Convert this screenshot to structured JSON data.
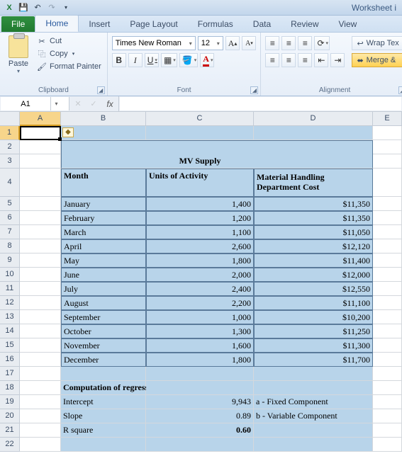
{
  "titlebar": {
    "title": "Worksheet i"
  },
  "tabs": {
    "file": "File",
    "list": [
      "Home",
      "Insert",
      "Page Layout",
      "Formulas",
      "Data",
      "Review",
      "View"
    ],
    "active": "Home"
  },
  "ribbon": {
    "clipboard": {
      "paste": "Paste",
      "cut": "Cut",
      "copy": "Copy",
      "format_painter": "Format Painter",
      "label": "Clipboard"
    },
    "font": {
      "name": "Times New Roman",
      "size": "12",
      "label": "Font"
    },
    "alignment": {
      "wrap": "Wrap Tex",
      "merge": "Merge &",
      "label": "Alignment"
    }
  },
  "namebox": "A1",
  "formula": "",
  "columns": [
    "A",
    "B",
    "C",
    "D",
    "E"
  ],
  "sheet": {
    "title": "MV Supply",
    "headers": {
      "month": "Month",
      "units": "Units of Activity",
      "cost": "Material Handling Department Cost"
    },
    "rows": [
      {
        "month": "January",
        "units": "1,400",
        "cost": "$11,350"
      },
      {
        "month": "February",
        "units": "1,200",
        "cost": "$11,350"
      },
      {
        "month": "March",
        "units": "1,100",
        "cost": "$11,050"
      },
      {
        "month": "April",
        "units": "2,600",
        "cost": "$12,120"
      },
      {
        "month": "May",
        "units": "1,800",
        "cost": "$11,400"
      },
      {
        "month": "June",
        "units": "2,000",
        "cost": "$12,000"
      },
      {
        "month": "July",
        "units": "2,400",
        "cost": "$12,550"
      },
      {
        "month": "August",
        "units": "2,200",
        "cost": "$11,100"
      },
      {
        "month": "September",
        "units": "1,000",
        "cost": "$10,200"
      },
      {
        "month": "October",
        "units": "1,300",
        "cost": "$11,250"
      },
      {
        "month": "November",
        "units": "1,600",
        "cost": "$11,300"
      },
      {
        "month": "December",
        "units": "1,800",
        "cost": "$11,700"
      }
    ],
    "regression": {
      "title": "Computation of regression parameters using excel functions",
      "intercept_l": "Intercept",
      "intercept_v": "9,943",
      "intercept_n": "a - Fixed Component",
      "slope_l": "Slope",
      "slope_v": "0.89",
      "slope_n": "b - Variable Component",
      "rsq_l": "R square",
      "rsq_v": "0.60"
    }
  },
  "chart_data": {
    "type": "table",
    "title": "MV Supply",
    "columns": [
      "Month",
      "Units of Activity",
      "Material Handling Department Cost"
    ],
    "rows": [
      [
        "January",
        1400,
        11350
      ],
      [
        "February",
        1200,
        11350
      ],
      [
        "March",
        1100,
        11050
      ],
      [
        "April",
        2600,
        12120
      ],
      [
        "May",
        1800,
        11400
      ],
      [
        "June",
        2000,
        12000
      ],
      [
        "July",
        2400,
        12550
      ],
      [
        "August",
        2200,
        11100
      ],
      [
        "September",
        1000,
        10200
      ],
      [
        "October",
        1300,
        11250
      ],
      [
        "November",
        1600,
        11300
      ],
      [
        "December",
        1800,
        11700
      ]
    ],
    "regression": {
      "intercept": 9943,
      "slope": 0.89,
      "r_square": 0.6
    }
  }
}
